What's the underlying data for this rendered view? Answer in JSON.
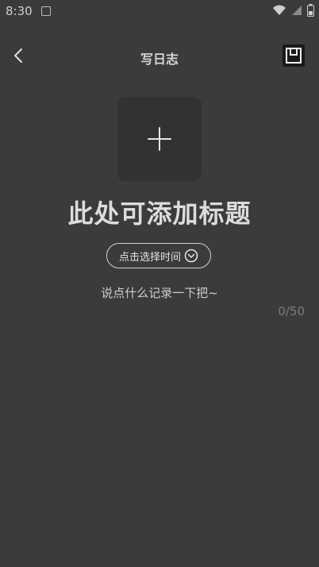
{
  "status_bar": {
    "time": "8:30"
  },
  "header": {
    "title": "写日志"
  },
  "main": {
    "headline": "此处可添加标题",
    "time_selector_label": "点击选择时间",
    "description": "说点什么记录一下把~",
    "counter": "0/50"
  },
  "icons": {
    "back": "chevron-left",
    "save": "save",
    "add": "plus",
    "dropdown": "chevron-down-circle"
  }
}
